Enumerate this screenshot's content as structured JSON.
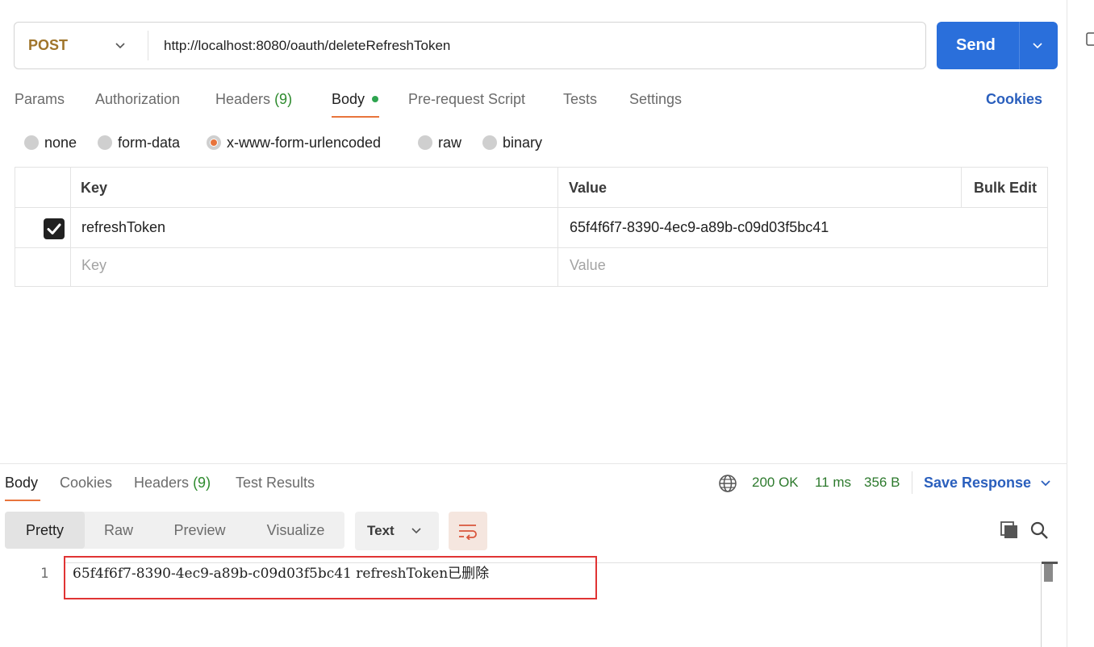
{
  "request": {
    "method": "POST",
    "url": "http://localhost:8080/oauth/deleteRefreshToken",
    "send_label": "Send"
  },
  "request_tabs": [
    {
      "label": "Params"
    },
    {
      "label": "Authorization"
    },
    {
      "label": "Headers",
      "count": "(9)"
    },
    {
      "label": "Body"
    },
    {
      "label": "Pre-request Script"
    },
    {
      "label": "Tests"
    },
    {
      "label": "Settings"
    }
  ],
  "cookies_link": "Cookies",
  "body_types": [
    {
      "label": "none"
    },
    {
      "label": "form-data"
    },
    {
      "label": "x-www-form-urlencoded",
      "selected": true
    },
    {
      "label": "raw"
    },
    {
      "label": "binary"
    }
  ],
  "table": {
    "headers": {
      "key": "Key",
      "value": "Value",
      "bulk_edit": "Bulk Edit"
    },
    "rows": [
      {
        "checked": true,
        "key": "refreshToken",
        "value": "65f4f6f7-8390-4ec9-a89b-c09d03f5bc41"
      }
    ],
    "placeholder": {
      "key": "Key",
      "value": "Value"
    }
  },
  "response_tabs": [
    {
      "label": "Body"
    },
    {
      "label": "Cookies"
    },
    {
      "label": "Headers",
      "count": "(9)"
    },
    {
      "label": "Test Results"
    }
  ],
  "status": {
    "code": "200 OK",
    "time": "11 ms",
    "size": "356 B"
  },
  "save_response": "Save Response",
  "view_modes": [
    "Pretty",
    "Raw",
    "Preview",
    "Visualize"
  ],
  "format": "Text",
  "editor": {
    "line_number": "1",
    "content": "65f4f6f7-8390-4ec9-a89b-c09d03f5bc41 refreshToken已删除"
  },
  "colors": {
    "accent": "#e8743c",
    "send": "#2a6fdb",
    "method": "#a0752b",
    "link": "#2a5fbd",
    "status_ok": "#2d7a2d",
    "highlight_box": "#e03434"
  }
}
